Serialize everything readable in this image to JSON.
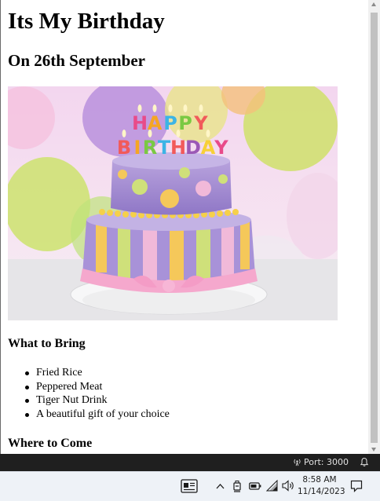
{
  "page": {
    "title": "Its My Birthday",
    "subtitle": "On 26th September",
    "bring_heading": "What to Bring",
    "bring_items": [
      "Fried Rice",
      "Peppered Meat",
      "Tiger Nut Drink",
      "A beautiful gift of your choice"
    ],
    "come_heading": "Where to Come"
  },
  "cake_image": {
    "icon": "birthday-cake-image",
    "candle_letters_top": [
      "H",
      "A",
      "P",
      "P",
      "Y"
    ],
    "candle_letters_bottom": [
      "B",
      "I",
      "R",
      "T",
      "H",
      "D",
      "A",
      "Y"
    ],
    "letter_colors": [
      "#e84b8a",
      "#f5a623",
      "#3cb4e5",
      "#7ac943",
      "#f15a5a",
      "#9b59b6",
      "#f7d038",
      "#e84b8a"
    ]
  },
  "statusbar": {
    "port_label": "Port: 3000",
    "port_icon": "broadcast-icon",
    "bell_icon": "bell-icon",
    "background": "#1f1f1f"
  },
  "taskbar": {
    "time": "8:58 AM",
    "date": "11/14/2023",
    "icons": [
      "news-widget-icon",
      "chevron-up-icon",
      "touch-keyboard-icon",
      "battery-icon",
      "wifi-icon",
      "volume-icon",
      "notifications-icon"
    ]
  }
}
